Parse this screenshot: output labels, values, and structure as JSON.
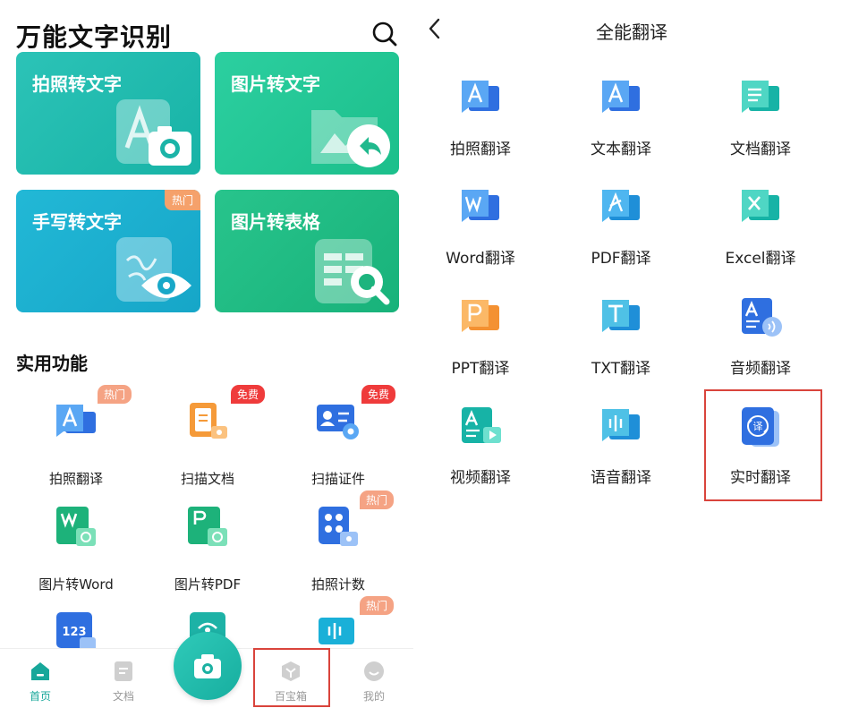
{
  "left": {
    "app_title": "万能文字识别",
    "cards": [
      {
        "label": "拍照转文字"
      },
      {
        "label": "图片转文字"
      },
      {
        "label": "手写转文字",
        "tag": "热门"
      },
      {
        "label": "图片转表格"
      }
    ],
    "section_title": "实用功能",
    "features": [
      {
        "label": "拍照翻译",
        "badge": "热门"
      },
      {
        "label": "扫描文档",
        "badge": "免费"
      },
      {
        "label": "扫描证件",
        "badge": "免费"
      },
      {
        "label": "图片转Word"
      },
      {
        "label": "图片转PDF"
      },
      {
        "label": "拍照计数",
        "badge": "热门"
      },
      {
        "label": ""
      },
      {
        "label": ""
      },
      {
        "label": "",
        "badge": "热门"
      }
    ],
    "nav": [
      {
        "label": "首页"
      },
      {
        "label": "文档"
      },
      {
        "label": "百宝箱"
      },
      {
        "label": "我的"
      }
    ]
  },
  "right": {
    "title": "全能翻译",
    "items": [
      {
        "label": "拍照翻译"
      },
      {
        "label": "文本翻译"
      },
      {
        "label": "文档翻译"
      },
      {
        "label": "Word翻译"
      },
      {
        "label": "PDF翻译"
      },
      {
        "label": "Excel翻译"
      },
      {
        "label": "PPT翻译"
      },
      {
        "label": "TXT翻译"
      },
      {
        "label": "音频翻译"
      },
      {
        "label": "视频翻译"
      },
      {
        "label": "语音翻译"
      },
      {
        "label": "实时翻译"
      }
    ]
  },
  "colors": {
    "accent": "#17a79a",
    "highlight_box": "#d9443c",
    "badge_hot": "#f5a384",
    "badge_free": "#ef3b3b"
  }
}
